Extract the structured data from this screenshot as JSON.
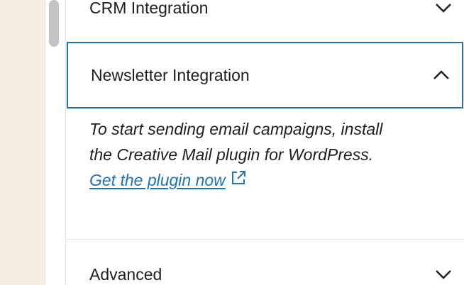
{
  "sections": {
    "crm": {
      "title": "CRM Integration",
      "state": "collapsed"
    },
    "newsletter": {
      "title": "Newsletter Integration",
      "state": "expanded",
      "description_line1": "To start sending email campaigns, install",
      "description_line2": "the Creative Mail plugin for WordPress.",
      "link_label": "Get the plugin now"
    },
    "advanced": {
      "title": "Advanced",
      "state": "collapsed"
    }
  },
  "icons": {
    "collapsed": "chevron-down-icon",
    "expanded": "chevron-up-icon",
    "link": "external-link-icon"
  },
  "colors": {
    "link": "#2271b1",
    "focus_border": "#2271b1",
    "sidebar_bg": "#f4efe1",
    "text": "#1e1e1e"
  }
}
